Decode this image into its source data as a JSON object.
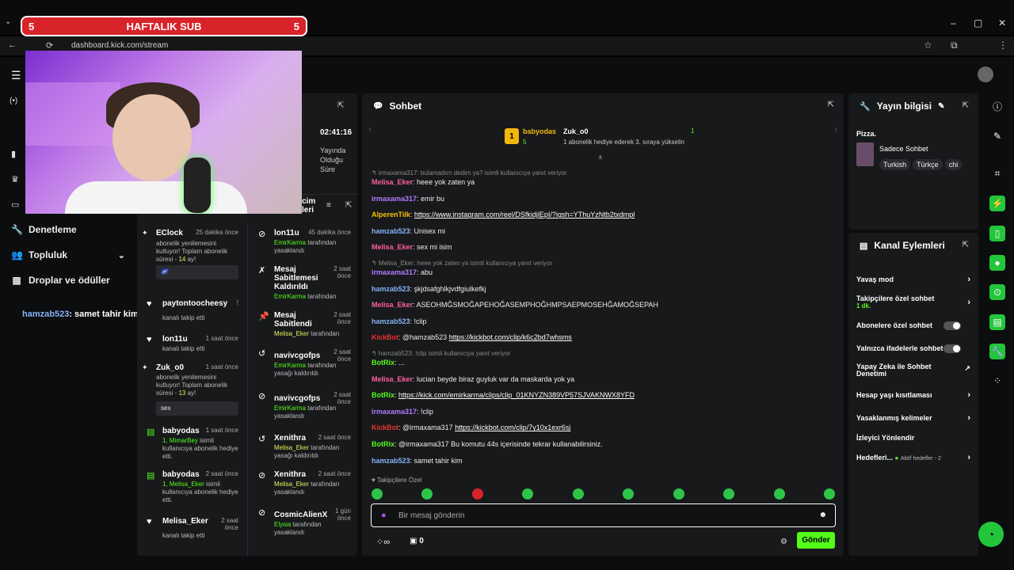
{
  "browser": {
    "banner_left": "5",
    "banner_title": "HAFTALIK SUB",
    "banner_right": "5",
    "url": "dashboard.kick.com/stream"
  },
  "sidebar": {
    "items": [
      {
        "label": "Denetleme",
        "icon": "wrench-icon"
      },
      {
        "label": "Topluluk",
        "icon": "users-icon"
      },
      {
        "label": "Droplar ve ödüller",
        "icon": "gift-icon"
      }
    ]
  },
  "overlay": {
    "user": "hamzab523",
    "text": ": samet tahir kim"
  },
  "stream_stats": {
    "time": "02:41:16",
    "status": "Yayında Olduğu Süre",
    "mod_header": "cim\nleri"
  },
  "activity_feed": [
    {
      "name": "EClock",
      "time": "25 dakika önce",
      "text": "abonelik yenilemesini kutluyor! Toplam abonelik süresi - ",
      "count": "14",
      "suffix": " ay!"
    },
    {
      "name": "paytontoocheesy",
      "time": "!",
      "text": "kanalı takip etti"
    },
    {
      "name": "lon11u",
      "time": "1 saat önce",
      "text": "kanalı takip etti"
    },
    {
      "name": "Zuk_o0",
      "time": "1 saat önce",
      "text": "abonelik yenilemesini kutluyor! Toplam abonelik süresi - ",
      "count": "13",
      "suffix": " ay!",
      "message": "sex"
    },
    {
      "name": "babyodas",
      "time": "1 saat önce",
      "gift_to": "1, MimarBey",
      "text": " isimli kullanıcıya abonelik hediye etti."
    },
    {
      "name": "babyodas",
      "time": "2 saat önce",
      "gift_to": "1, Melisa_Eker",
      "text": " isimli kullanıcıya abonelik hediye etti."
    },
    {
      "name": "Melisa_Eker",
      "time": "2 saat önce",
      "text": "kanalı takip etti"
    }
  ],
  "mod_log": [
    {
      "name": "lon11u",
      "time": "45 dakika önce",
      "by": "EmirKarma",
      "text": " tarafından yasaklandı"
    },
    {
      "name": "Mesaj Sabitlemesi Kaldırıldı",
      "time": "2 saat önce",
      "by": "EmirKarma",
      "text": " tarafından"
    },
    {
      "name": "Mesaj Sabitlendi",
      "time": "2 saat önce",
      "by": "Melisa_Eker",
      "text": " tarafından"
    },
    {
      "name": "navivcgofps",
      "time": "2 saat önce",
      "by": "EmirKarma",
      "text": " tarafından yasağı kaldırıldı"
    },
    {
      "name": "navivcgofps",
      "time": "2 saat önce",
      "by": "EmirKarma",
      "text": " tarafından yasaklandı"
    },
    {
      "name": "Xenithra",
      "time": "2 saat önce",
      "by": "Melisa_Eker",
      "text": " tarafından yasağı kaldırıldı"
    },
    {
      "name": "Xenithra",
      "time": "2 saat önce",
      "by": "Melisa_Eker",
      "text": " tarafından yasaklandı"
    },
    {
      "name": "CosmicAlienX",
      "time": "1 gün önce",
      "by": "Elysia",
      "text": " tarafından yasaklandı"
    }
  ],
  "chat": {
    "title": "Sohbet",
    "pinned": {
      "user": "babyodas",
      "count": "5",
      "target": "Zuk_o0",
      "num": "1",
      "desc": "1 abonelik hediye ederek 3. sıraya yükselin"
    },
    "lines": [
      {
        "reply": "irmaxama317: bulamadım dedim ya? isimli kullanıcıya yanıt veriyor"
      },
      {
        "user": "Melisa_Eker",
        "color": "#ff5fa2",
        "text": ": heee yok zaten ya"
      },
      {
        "user": "irmaxama317",
        "color": "#b07cff",
        "text": ": emir bu"
      },
      {
        "user": "AlperenTilk",
        "color": "#f5c400",
        "link": "https://www.instagram.com/reel/DSfkidjlEpI/?igsh=YThuYzNtb2txdmpl",
        "text": ": "
      },
      {
        "user": "hamzab523",
        "color": "#86b3f7",
        "text": ": Unisex mi"
      },
      {
        "user": "Melisa_Eker",
        "color": "#ff5fa2",
        "text": ": sex mi isim"
      },
      {
        "reply": "Melisa_Eker: heee yok zaten ya isimli kullanıcıya yanıt veriyor"
      },
      {
        "user": "irmaxama317",
        "color": "#b07cff",
        "text": ": abu"
      },
      {
        "user": "hamzab523",
        "color": "#86b3f7",
        "text": ": şkjdsafghlkjvdfgiulkefkj"
      },
      {
        "user": "Melisa_Eker",
        "color": "#ff5fa2",
        "text": ": ASEOHMĞSMOĞAPEHOĞASEMPHOĞHMPSAEPMOSEHĞAMOĞSEPAH"
      },
      {
        "user": "hamzab523",
        "color": "#86b3f7",
        "text": ": !clip"
      },
      {
        "user": "KickBot",
        "color": "#e8332f",
        "text": ": @hamzab523 ",
        "link": "https://kickbot.com/clip/k6c2bd7whsms"
      },
      {
        "reply": "hamzab523: !clip isimli kullanıcıya yanıt veriyor"
      },
      {
        "user": "BotRix",
        "color": "#53fc18",
        "text": ": ..."
      },
      {
        "user": "Melisa_Eker",
        "color": "#ff5fa2",
        "text": ": lucian beyde biraz guyluk var da maskarda yok ya"
      },
      {
        "user": "BotRix",
        "color": "#53fc18",
        "text": ": ",
        "link": "https://kick.com/emirkarma/clips/clip_01KNYZN389VP57SJVAKNWX8YFD"
      },
      {
        "user": "irmaxama317",
        "color": "#b07cff",
        "text": ": !clip"
      },
      {
        "user": "KickBot",
        "color": "#e8332f",
        "text": ": @irmaxama317 ",
        "link": "https://kickbot.com/clip/7y10x1exr6sj"
      },
      {
        "user": "BotRix",
        "color": "#53fc18",
        "text": ": @irmaxama317 Bu komutu 44s içerisinde tekrar kullanabilirsiniz."
      },
      {
        "user": "hamzab523",
        "color": "#86b3f7",
        "text": ": samet tahir kim"
      }
    ],
    "followers_only": "Takipçilere Özel",
    "input_placeholder": "Bir mesaj gönderin",
    "points": "0",
    "send_label": "Gönder"
  },
  "stream_info": {
    "title": "Yayın bilgisi",
    "stream_title": "Pizza.",
    "category": "Sadece Sohbet",
    "tags": [
      "Turkish",
      "Türkçe",
      "chi"
    ]
  },
  "channel_actions": {
    "title": "Kanal Eylemleri",
    "items": [
      {
        "label": "Yavaş mod",
        "kind": "chevron"
      },
      {
        "label": "Takipçilere özel sohbet",
        "sub": "1 dk.",
        "kind": "chevron"
      },
      {
        "label": "Abonelere özel sohbet",
        "kind": "toggle"
      },
      {
        "label": "Yalnızca ifadelerle sohbet",
        "kind": "toggle"
      },
      {
        "label": "Yapay Zeka ile Sohbet Denetimi",
        "kind": "external"
      },
      {
        "label": "Hesap yaşı kısıtlaması",
        "kind": "chevron"
      },
      {
        "label": "Yasaklanmış kelimeler",
        "kind": "chevron"
      },
      {
        "label": "İzleyici Yönlendir",
        "kind": "none"
      },
      {
        "label": "Hedefleri...",
        "sub": "Aktif hedefler - 2",
        "kind": "chevron"
      }
    ]
  },
  "colors": {
    "accent": "#53fc18",
    "panel": "#18191b",
    "banner": "#d8232a"
  }
}
